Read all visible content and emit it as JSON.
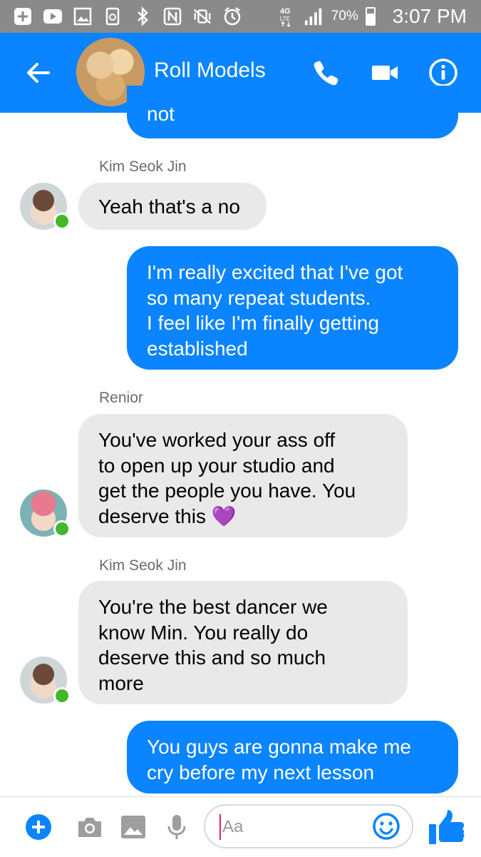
{
  "status_bar": {
    "battery": "70%",
    "battery_level": 0.7,
    "network": "4G LTE",
    "time": "3:07 PM"
  },
  "header": {
    "title": "Roll Models"
  },
  "messages": [
    {
      "type": "outgoing",
      "text": "not"
    },
    {
      "type": "sender",
      "text": "Kim Seok Jin"
    },
    {
      "type": "incoming",
      "text": "Yeah that's a no"
    },
    {
      "type": "outgoing",
      "lines": [
        "I'm really excited that I've got",
        "so many repeat students.",
        "I feel like I'm finally getting",
        "established"
      ]
    },
    {
      "type": "sender",
      "text": "Renior"
    },
    {
      "type": "incoming",
      "lines": [
        "You've worked your ass off",
        "to open up your studio and",
        "get the people you have. You",
        "deserve this"
      ],
      "emoji": "💜"
    },
    {
      "type": "sender",
      "text": "Kim Seok Jin"
    },
    {
      "type": "incoming",
      "lines": [
        "You're the best dancer we",
        "know Min. You really do",
        "deserve this and so much",
        "more"
      ]
    },
    {
      "type": "outgoing",
      "lines": [
        "You guys are gonna make me",
        "cry before my next lesson"
      ]
    }
  ],
  "composer": {
    "placeholder": "Aa"
  },
  "colors": {
    "accent": "#0a84ff",
    "incoming_bubble": "#e9e9e9",
    "status_bar": "#8a8a8a",
    "online": "#42b72a"
  }
}
